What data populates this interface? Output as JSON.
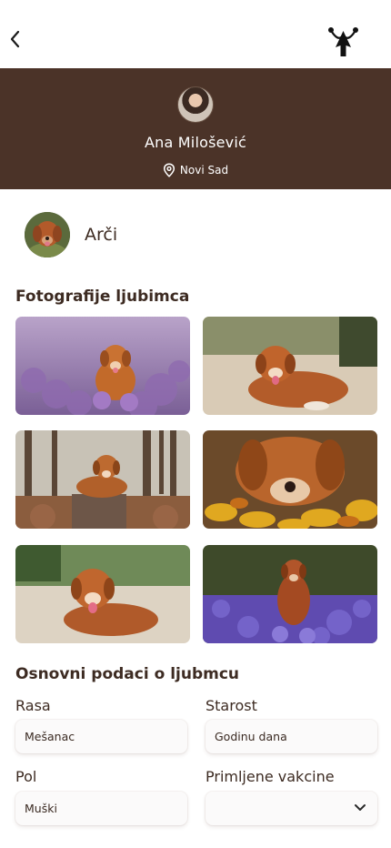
{
  "header": {
    "back_icon": "chevron-left-icon",
    "logo_icon": "app-logo-icon"
  },
  "owner": {
    "name": "Ana Milošević",
    "location": "Novi Sad",
    "location_icon": "location-pin-icon"
  },
  "pet": {
    "name": "Arči"
  },
  "photos_section": {
    "title": "Fotografije ljubimca",
    "count": 6
  },
  "details_section": {
    "title": "Osnovni podaci o ljubmcu",
    "breed_label": "Rasa",
    "breed_value": "Mešanac",
    "age_label": "Starost",
    "age_value": "Godinu dana",
    "sex_label": "Pol",
    "sex_value": "Muški",
    "vaccines_label": "Primljene vakcine",
    "vaccines_value": ""
  },
  "colors": {
    "brand_brown": "#4b3328",
    "text": "#3d2b22"
  }
}
